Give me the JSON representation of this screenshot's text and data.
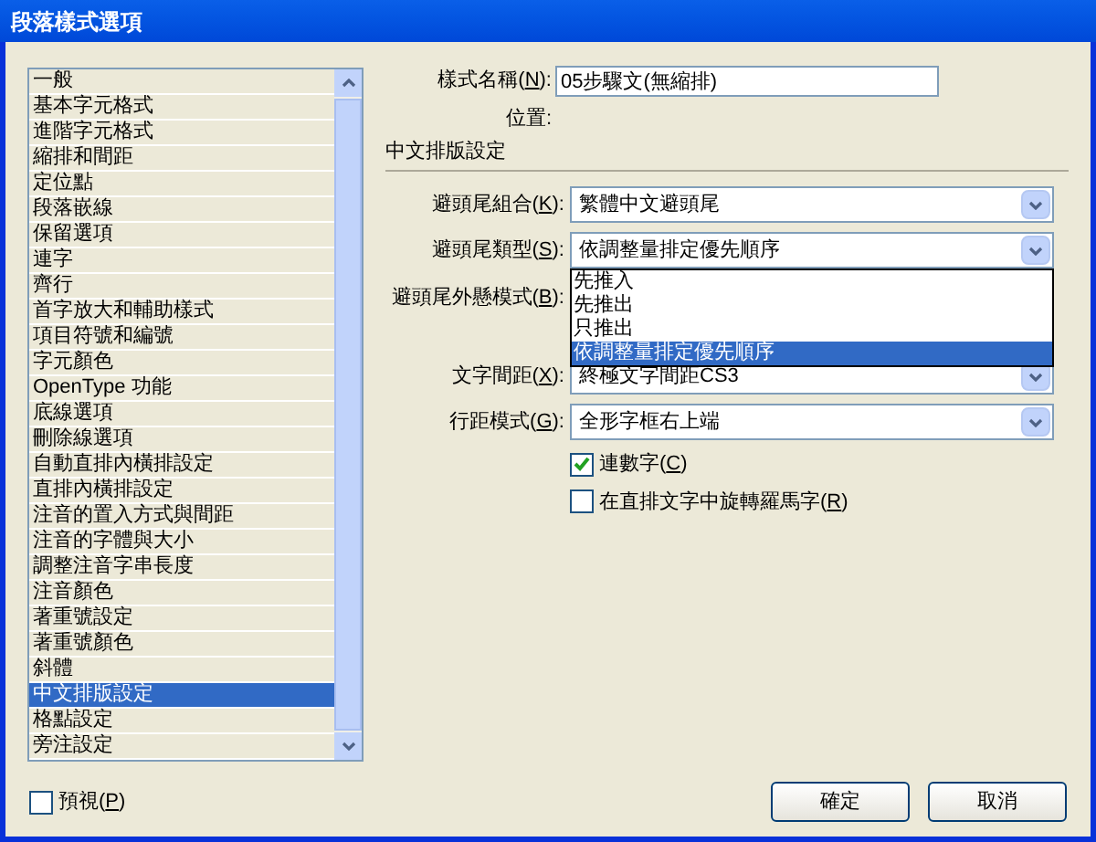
{
  "window": {
    "title": "段落樣式選項"
  },
  "sidebar": {
    "items": [
      {
        "label": "一般",
        "selected": false
      },
      {
        "label": "基本字元格式",
        "selected": false
      },
      {
        "label": "進階字元格式",
        "selected": false
      },
      {
        "label": "縮排和間距",
        "selected": false
      },
      {
        "label": "定位點",
        "selected": false
      },
      {
        "label": "段落嵌線",
        "selected": false
      },
      {
        "label": "保留選項",
        "selected": false
      },
      {
        "label": "連字",
        "selected": false
      },
      {
        "label": "齊行",
        "selected": false
      },
      {
        "label": "首字放大和輔助樣式",
        "selected": false
      },
      {
        "label": "項目符號和編號",
        "selected": false
      },
      {
        "label": "字元顏色",
        "selected": false
      },
      {
        "label": "OpenType 功能",
        "selected": false
      },
      {
        "label": "底線選項",
        "selected": false
      },
      {
        "label": "刪除線選項",
        "selected": false
      },
      {
        "label": "自動直排內橫排設定",
        "selected": false
      },
      {
        "label": "直排內橫排設定",
        "selected": false
      },
      {
        "label": "注音的置入方式與間距",
        "selected": false
      },
      {
        "label": "注音的字體與大小",
        "selected": false
      },
      {
        "label": "調整注音字串長度",
        "selected": false
      },
      {
        "label": "注音顏色",
        "selected": false
      },
      {
        "label": "著重號設定",
        "selected": false
      },
      {
        "label": "著重號顏色",
        "selected": false
      },
      {
        "label": "斜體",
        "selected": false
      },
      {
        "label": "中文排版設定",
        "selected": true
      },
      {
        "label": "格點設定",
        "selected": false
      },
      {
        "label": "旁注設定",
        "selected": false
      }
    ]
  },
  "style_name": {
    "label_before": "樣式名稱(",
    "mnemonic": "N",
    "label_after": "):",
    "value": "05步驟文(無縮排)"
  },
  "location_label": "位置:",
  "section_title": "中文排版設定",
  "dropdowns": [
    {
      "label_before": "避頭尾組合(",
      "mnemonic": "K",
      "label_after": "):",
      "value": "繁體中文避頭尾"
    },
    {
      "label_before": "避頭尾類型(",
      "mnemonic": "S",
      "label_after": "):",
      "value": "依調整量排定優先順序",
      "open": true,
      "options": [
        {
          "label": "先推入",
          "selected": false
        },
        {
          "label": "先推出",
          "selected": false
        },
        {
          "label": "只推出",
          "selected": false
        },
        {
          "label": "依調整量排定優先順序",
          "selected": true
        }
      ]
    },
    {
      "label_before": "避頭尾外懸模式(",
      "mnemonic": "B",
      "label_after": "):"
    },
    {
      "label_before": "文字間距(",
      "mnemonic": "X",
      "label_after": "):",
      "value": "終極文字間距CS3"
    },
    {
      "label_before": "行距模式(",
      "mnemonic": "G",
      "label_after": "):",
      "value": "全形字框右上端"
    }
  ],
  "checkboxes": [
    {
      "label_before": "連數字(",
      "mnemonic": "C",
      "label_after": ")",
      "checked": true
    },
    {
      "label_before": "在直排文字中旋轉羅馬字(",
      "mnemonic": "R",
      "label_after": ")",
      "checked": false
    }
  ],
  "preview": {
    "label_before": "預視(",
    "mnemonic": "P",
    "label_after": ")",
    "checked": false
  },
  "buttons": [
    "確定",
    "取消"
  ]
}
